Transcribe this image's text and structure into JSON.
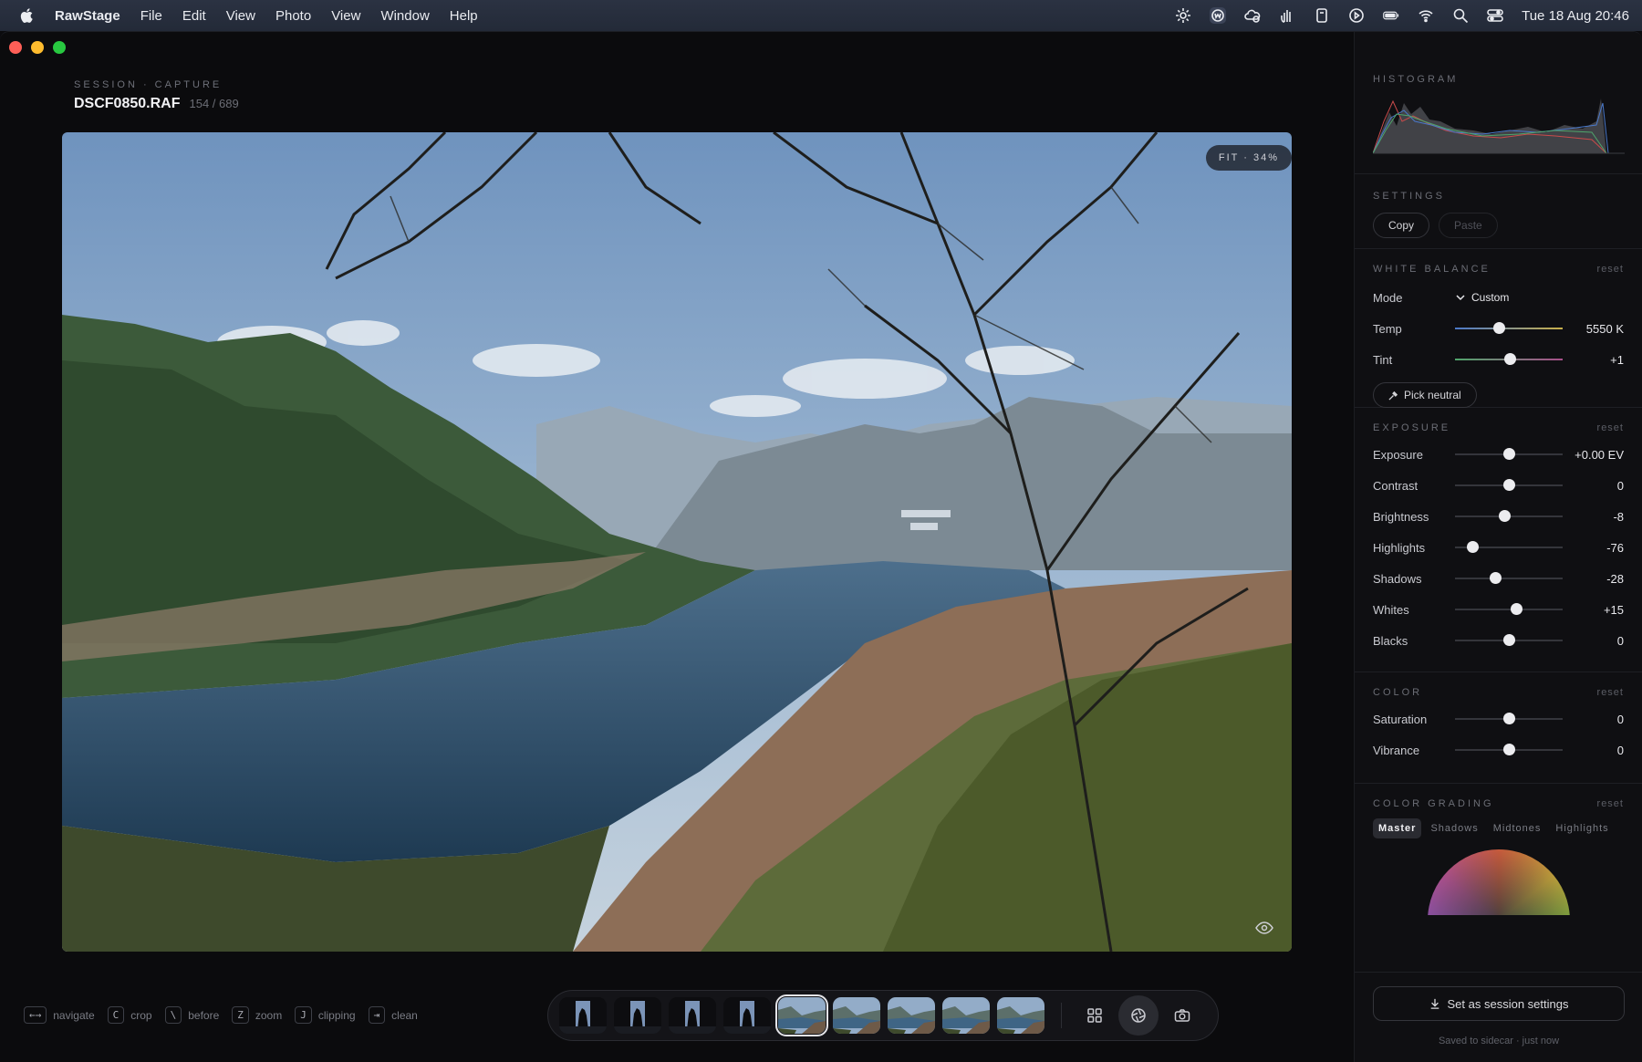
{
  "menubar": {
    "app_name": "RawStage",
    "items": [
      "File",
      "Edit",
      "View",
      "Photo",
      "View",
      "Window",
      "Help"
    ],
    "clock": "Tue 18 Aug  20:46"
  },
  "session": {
    "label": "SESSION · CAPTURE",
    "filename": "DSCF0850.RAF",
    "count": "154 / 689"
  },
  "viewer": {
    "zoom_label": "FIT · 34%"
  },
  "hints": [
    {
      "key": "←→",
      "label": "navigate"
    },
    {
      "key": "C",
      "label": "crop"
    },
    {
      "key": "\\",
      "label": "before"
    },
    {
      "key": "Z",
      "label": "zoom"
    },
    {
      "key": "J",
      "label": "clipping"
    },
    {
      "key": "⇥",
      "label": "clean"
    }
  ],
  "filmstrip": {
    "selected_index": 4,
    "thumbnails": [
      "silhouette",
      "silhouette",
      "silhouette",
      "silhouette",
      "bay",
      "bay",
      "bay",
      "bay",
      "bay"
    ]
  },
  "panel": {
    "histogram": {
      "title": "HISTOGRAM"
    },
    "settings": {
      "title": "SETTINGS",
      "copy": "Copy",
      "paste": "Paste"
    },
    "white_balance": {
      "title": "WHITE BALANCE",
      "reset": "reset",
      "mode_label": "Mode",
      "mode_value": "Custom",
      "sliders": [
        {
          "label": "Temp",
          "value": "5550 K",
          "pos": 0.41
        },
        {
          "label": "Tint",
          "value": "+1",
          "pos": 0.51
        }
      ],
      "pick_neutral": "Pick neutral"
    },
    "exposure": {
      "title": "EXPOSURE",
      "reset": "reset",
      "sliders": [
        {
          "label": "Exposure",
          "value": "+0.00 EV",
          "pos": 0.5
        },
        {
          "label": "Contrast",
          "value": "0",
          "pos": 0.5
        },
        {
          "label": "Brightness",
          "value": "-8",
          "pos": 0.46
        },
        {
          "label": "Highlights",
          "value": "-76",
          "pos": 0.16
        },
        {
          "label": "Shadows",
          "value": "-28",
          "pos": 0.37
        },
        {
          "label": "Whites",
          "value": "+15",
          "pos": 0.57
        },
        {
          "label": "Blacks",
          "value": "0",
          "pos": 0.5
        }
      ]
    },
    "color": {
      "title": "COLOR",
      "reset": "reset",
      "sliders": [
        {
          "label": "Saturation",
          "value": "0",
          "pos": 0.5
        },
        {
          "label": "Vibrance",
          "value": "0",
          "pos": 0.5
        }
      ]
    },
    "color_grading": {
      "title": "COLOR GRADING",
      "reset": "reset",
      "tabs": [
        "Master",
        "Shadows",
        "Midtones",
        "Highlights"
      ],
      "active_tab": 0
    },
    "set_session": "Set as session settings",
    "saved_note": "Saved to sidecar · just now"
  }
}
